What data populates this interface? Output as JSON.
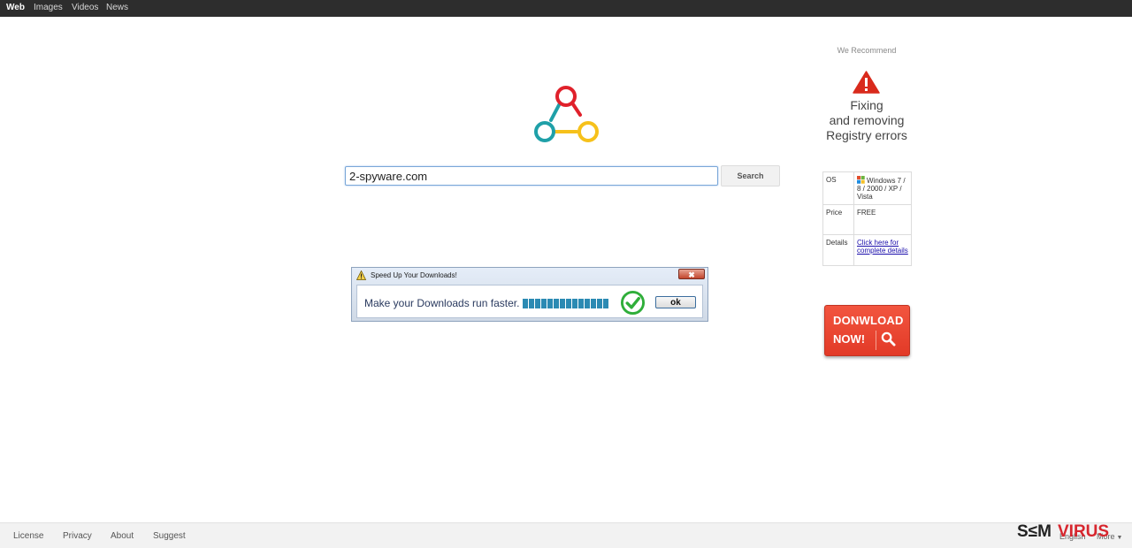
{
  "nav": {
    "items": [
      "Web",
      "Images",
      "Videos",
      "News"
    ]
  },
  "search": {
    "value": "2-spyware.com",
    "button": "Search"
  },
  "ad_popup": {
    "title": "Speed Up Your Downloads!",
    "close_glyph": "✖",
    "message": "Make your Downloads run faster.",
    "progress_segments": 14,
    "ok_label": "ok"
  },
  "recommend": {
    "heading": "We Recommend",
    "lines": [
      "Fixing",
      "and removing",
      "Registry errors"
    ],
    "icon": "warning-triangle-icon"
  },
  "info": {
    "os_label": "OS",
    "os_value": "Windows 7 / 8 / 2000 / XP / Vista",
    "price_label": "Price",
    "price_value": "FREE",
    "details_label": "Details",
    "details_link": "Click here for complete details"
  },
  "download": {
    "line1": "DONWLOAD",
    "line2": "NOW!"
  },
  "footer": {
    "links": [
      "License",
      "Privacy",
      "About",
      "Suggest"
    ],
    "language": "English",
    "more": "More"
  },
  "watermark": {
    "text": "S≤MVIRUS"
  },
  "colors": {
    "topbar": "#2d2d2d",
    "logo_red": "#e0212b",
    "logo_teal": "#1fa0a8",
    "logo_yellow": "#f6c11b",
    "download_red": "#e8432f",
    "progress": "#2b8ab3"
  }
}
